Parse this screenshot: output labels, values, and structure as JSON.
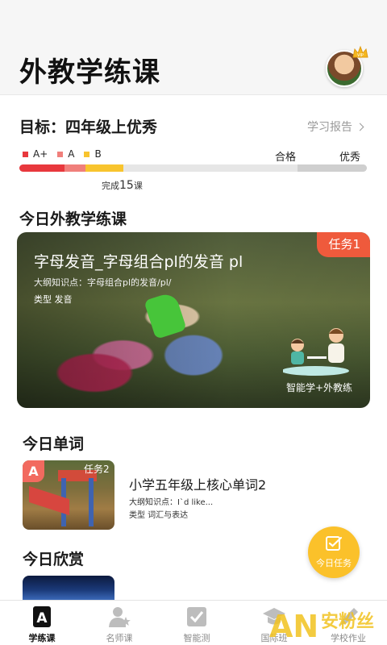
{
  "header": {
    "title": "外教学练课",
    "avatar_icon": "child-avatar",
    "vip_icon": "crown-vip-icon",
    "vip_label": "VIP"
  },
  "goal": {
    "text": "目标：四年级上优秀",
    "report_link": "学习报告"
  },
  "levels": {
    "legend": [
      {
        "label": "A+",
        "color": "#e8383d"
      },
      {
        "label": "A",
        "color": "#f07f7b"
      },
      {
        "label": "B",
        "color": "#f8c42e"
      }
    ],
    "pass_label": "合格",
    "excellent_label": "优秀"
  },
  "progress": {
    "done_prefix": "完成",
    "done_count": "15",
    "done_suffix": "课",
    "segments": [
      {
        "level": "A+",
        "fraction": 0.13,
        "color": "#e8383d"
      },
      {
        "level": "A",
        "fraction": 0.06,
        "color": "#f07f7b"
      },
      {
        "level": "B",
        "fraction": 0.11,
        "color": "#f8c42e"
      },
      {
        "level": "remaining",
        "fraction": 0.5,
        "color": "#e6e6e6"
      },
      {
        "level": "excellent-zone",
        "fraction": 0.2,
        "color": "#cfcfcf"
      }
    ]
  },
  "today_lesson": {
    "section_title": "今日外教学练课",
    "task_tag": "任务1",
    "title": "字母发音_字母组合pl的发音 pl",
    "outline": "大纲知识点：字母组合pl的发音/pl/",
    "type_label": "类型 发音",
    "badge": "智能学+外教练"
  },
  "today_words": {
    "section_title": "今日单词",
    "badge": "A",
    "task_tag": "任务2",
    "title": "小学五年级上核心单词2",
    "outline": "大纲知识点：I`d like...",
    "type_label": "类型 词汇与表达"
  },
  "today_enjoy": {
    "section_title": "今日欣赏"
  },
  "fab": {
    "label": "今日任务",
    "icon": "checklist-icon"
  },
  "tabbar": [
    {
      "label": "学练课",
      "icon": "letter-a-book-icon",
      "active": true
    },
    {
      "label": "名师课",
      "icon": "teacher-star-icon",
      "active": false
    },
    {
      "label": "智能测",
      "icon": "check-box-icon",
      "active": false
    },
    {
      "label": "国际班",
      "icon": "graduation-cap-icon",
      "active": false
    },
    {
      "label": "学校作业",
      "icon": "pencil-icon",
      "active": false
    }
  ],
  "watermark": {
    "text": "安粉丝",
    "logo": "AN"
  }
}
